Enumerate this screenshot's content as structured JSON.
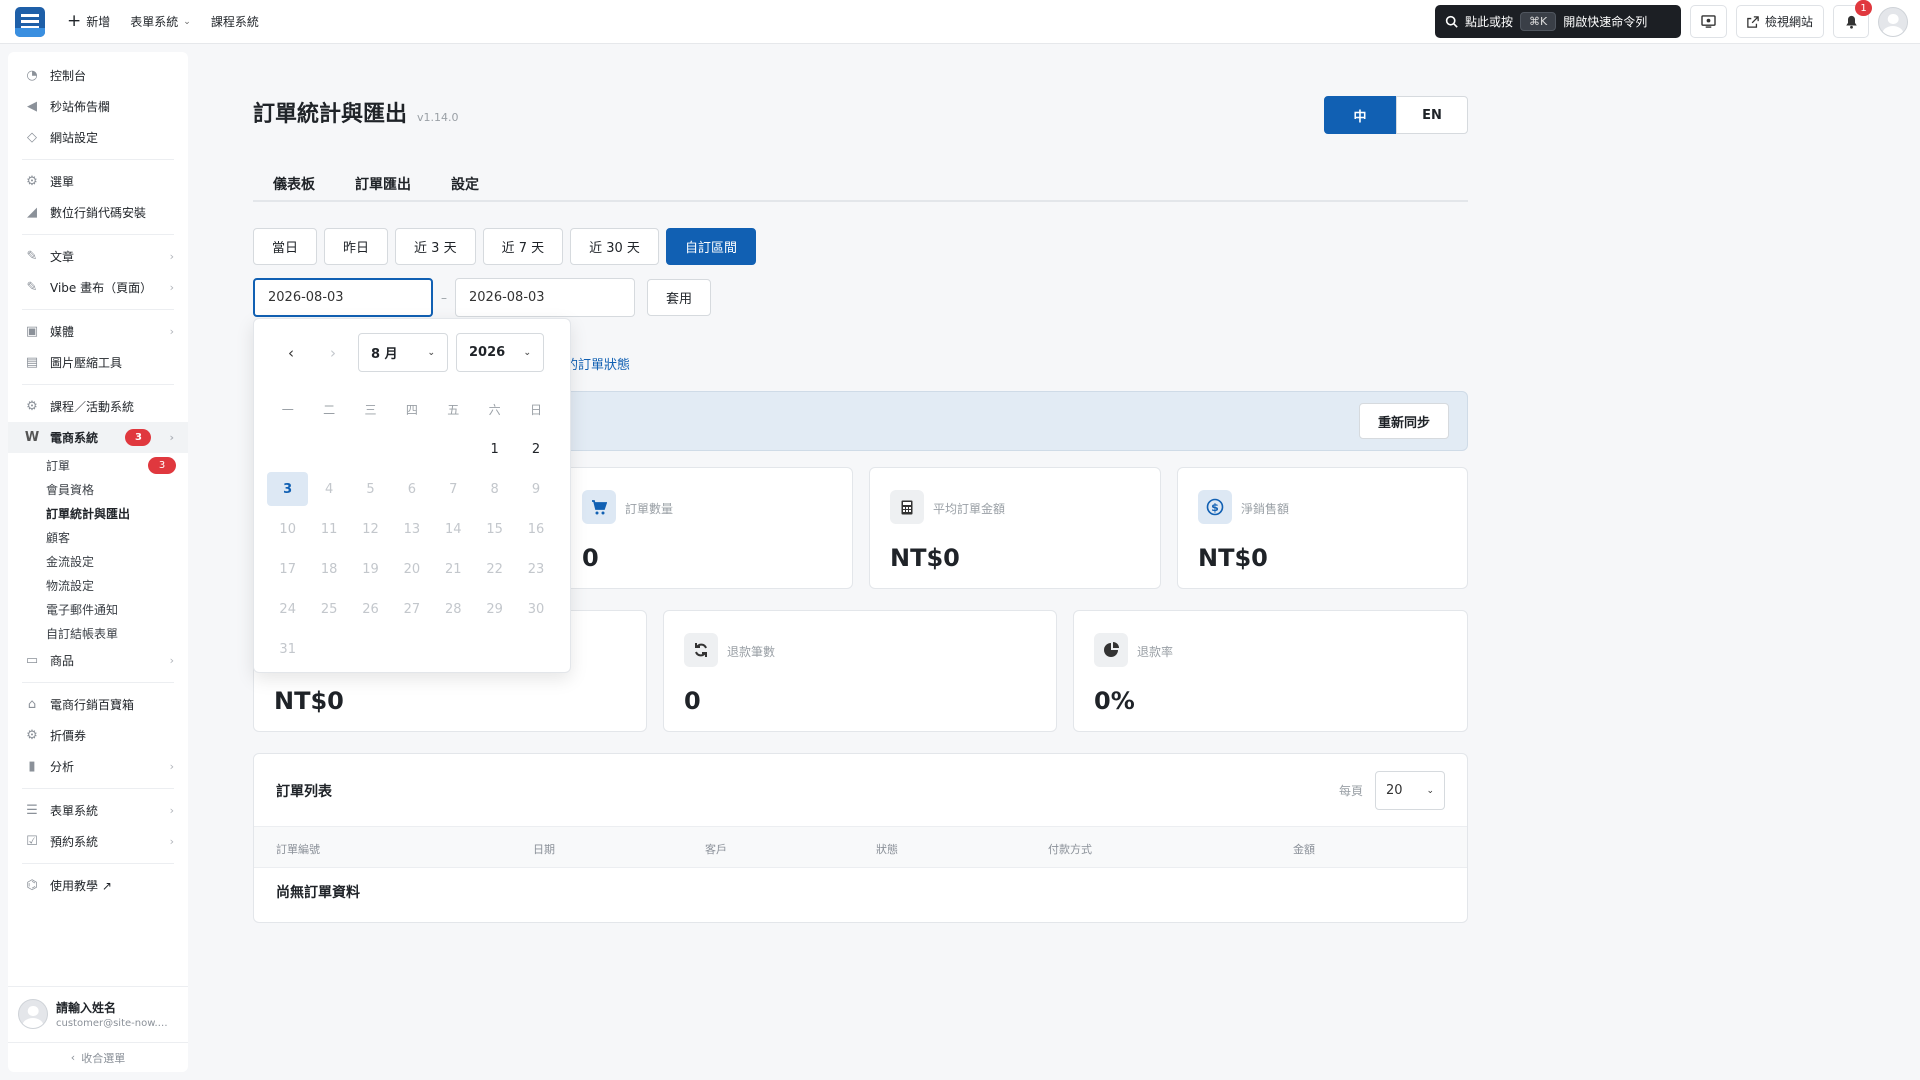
{
  "topbar": {
    "new_label": "新增",
    "form_system": "表單系統",
    "course_system": "課程系統",
    "cmd_text1": "點此或按",
    "cmd_kbd": "⌘K",
    "cmd_text2": "開啟快速命令列",
    "view_site": "檢視網站",
    "bell_count": "1"
  },
  "sidebar": {
    "items": [
      {
        "label": "控制台"
      },
      {
        "label": "秒站佈告欄"
      },
      {
        "label": "網站設定"
      },
      {
        "label": "選單"
      },
      {
        "label": "數位行銷代碼安裝"
      },
      {
        "label": "文章"
      },
      {
        "label": "Vibe 畫布（頁面）"
      },
      {
        "label": "媒體"
      },
      {
        "label": "圖片壓縮工具"
      },
      {
        "label": "課程／活動系統"
      },
      {
        "label": "電商系統",
        "badge": "3"
      },
      {
        "label": "商品"
      },
      {
        "label": "電商行銷百寶箱"
      },
      {
        "label": "折價券"
      },
      {
        "label": "分析"
      },
      {
        "label": "表單系統"
      },
      {
        "label": "預約系統"
      },
      {
        "label": "使用教學 ↗"
      }
    ],
    "sub": [
      {
        "label": "訂單",
        "badge": "3"
      },
      {
        "label": "會員資格"
      },
      {
        "label": "訂單統計與匯出"
      },
      {
        "label": "顧客"
      },
      {
        "label": "金流設定"
      },
      {
        "label": "物流設定"
      },
      {
        "label": "電子郵件通知"
      },
      {
        "label": "自訂結帳表單"
      }
    ],
    "user_name": "請輸入姓名",
    "user_email": "customer@site-now.…",
    "collapse": "收合選單"
  },
  "page": {
    "title": "訂單統計與匯出",
    "version": "v1.14.0",
    "lang_zh": "中",
    "lang_en": "EN",
    "tabs": [
      "儀表板",
      "訂單匯出",
      "設定"
    ],
    "ranges": [
      "當日",
      "昨日",
      "近 3 天",
      "近 7 天",
      "近 30 天",
      "自訂區間"
    ],
    "date_start": "2026-08-03",
    "date_end": "2026-08-03",
    "apply": "套用",
    "status_link": "的訂單狀態",
    "resync": "重新同步"
  },
  "stats": {
    "order_count_label": "訂單數量",
    "order_count": "0",
    "avg_label": "平均訂單金額",
    "avg": "NT$0",
    "net_label": "淨銷售額",
    "net": "NT$0",
    "hidden_value": "NT$0",
    "refund_count_label": "退款筆數",
    "refund_count": "0",
    "refund_rate_label": "退款率",
    "refund_rate": "0%"
  },
  "orders": {
    "title": "訂單列表",
    "per_page_label": "每頁",
    "per_page": "20",
    "columns": [
      "訂單編號",
      "日期",
      "客戶",
      "狀態",
      "付款方式",
      "金額"
    ],
    "empty": "尚無訂單資料"
  },
  "calendar": {
    "month": "8 月",
    "year": "2026",
    "weekdays": [
      "一",
      "二",
      "三",
      "四",
      "五",
      "六",
      "日"
    ],
    "weeks": [
      [
        "",
        "",
        "",
        "",
        "",
        "1",
        "2"
      ],
      [
        "3",
        "4",
        "5",
        "6",
        "7",
        "8",
        "9"
      ],
      [
        "10",
        "11",
        "12",
        "13",
        "14",
        "15",
        "16"
      ],
      [
        "17",
        "18",
        "19",
        "20",
        "21",
        "22",
        "23"
      ],
      [
        "24",
        "25",
        "26",
        "27",
        "28",
        "29",
        "30"
      ],
      [
        "31",
        "",
        "",
        "",
        "",
        "",
        ""
      ]
    ]
  },
  "colors": {
    "accent": "#1160b3",
    "badge": "#e0383e"
  }
}
